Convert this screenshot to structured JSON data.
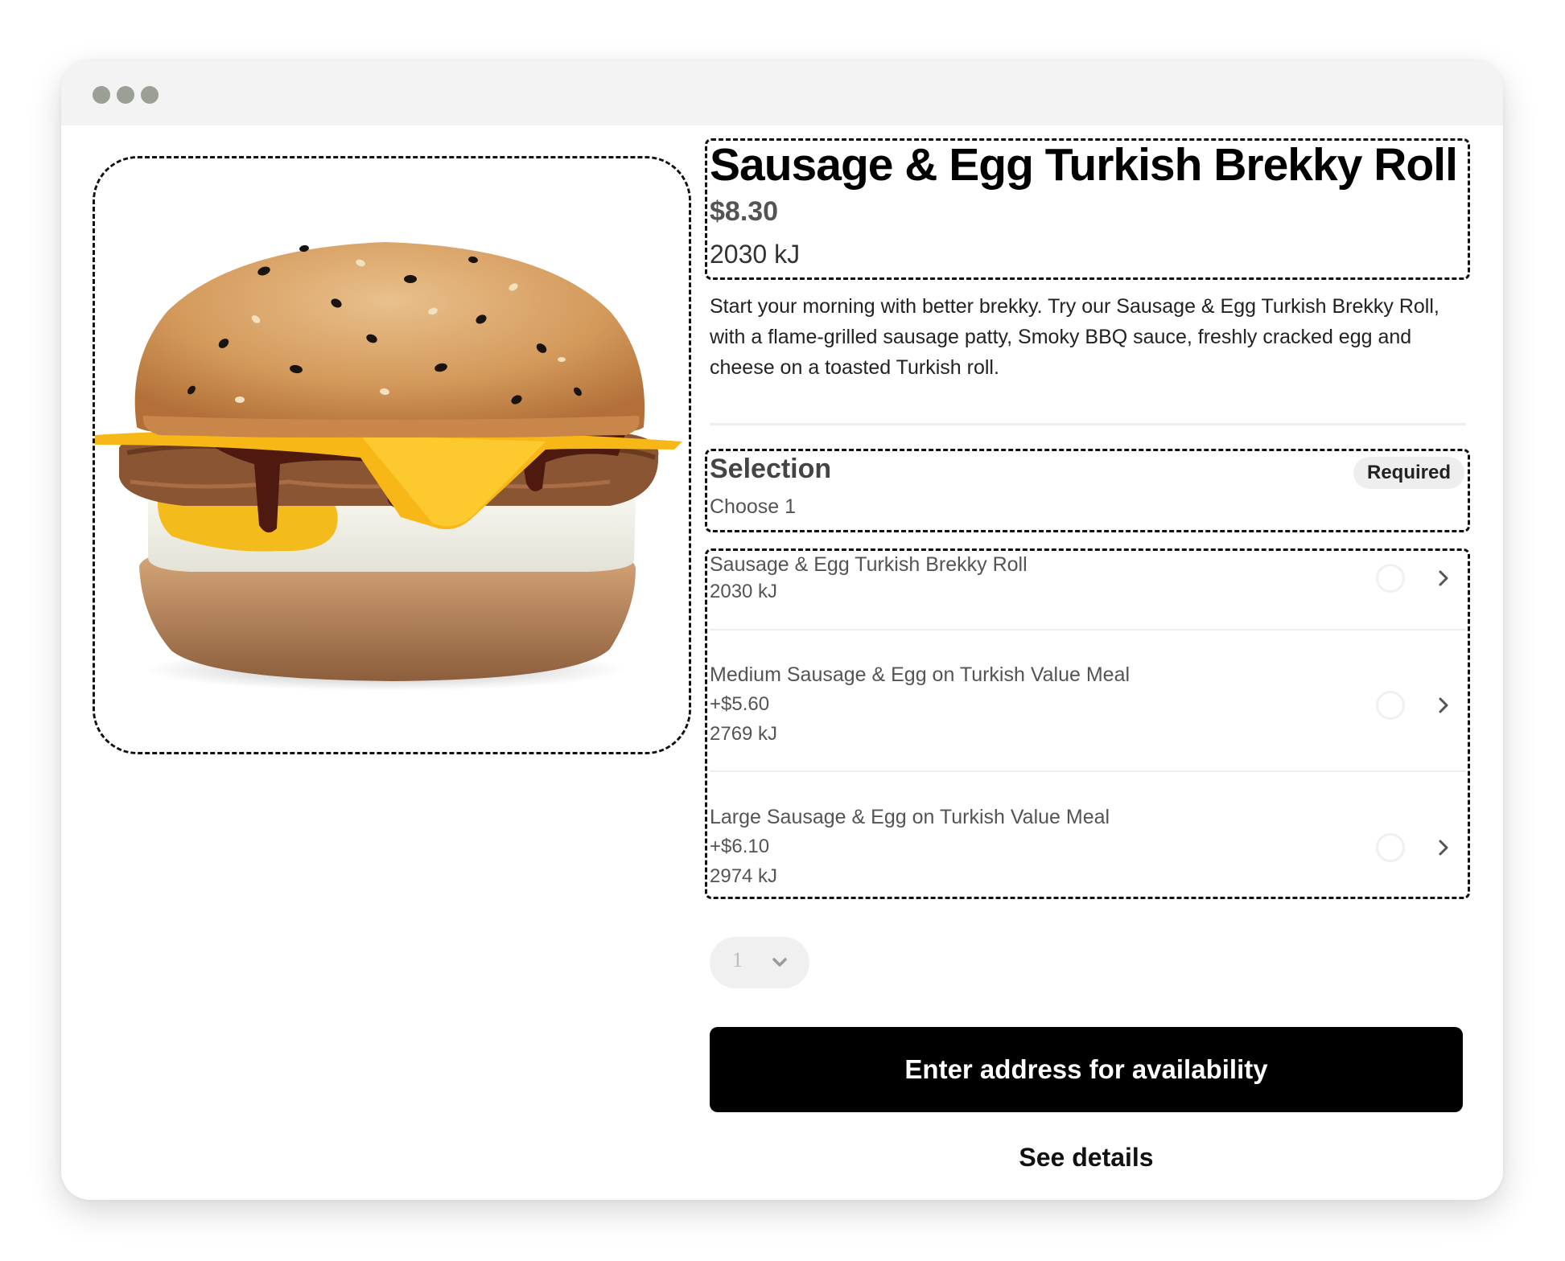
{
  "window": {
    "control_dot_color": "#9aa095"
  },
  "product": {
    "image_alt": "Sausage & Egg Turkish Brekky Roll",
    "title": "Sausage & Egg Turkish Brekky Roll",
    "price": "$8.30",
    "energy": "2030 kJ",
    "description": "Start your morning with better brekky. Try our Sausage & Egg Turkish Brekky Roll, with a flame-grilled sausage patty, Smoky BBQ sauce, freshly cracked egg and cheese on a toasted Turkish roll."
  },
  "selection": {
    "title": "Selection",
    "subtitle": "Choose 1",
    "required_label": "Required",
    "options": [
      {
        "name": "Sausage & Egg Turkish Brekky Roll",
        "price_delta": "",
        "energy": "2030 kJ",
        "selected": false
      },
      {
        "name": "Medium Sausage & Egg on Turkish Value Meal",
        "price_delta": "+$5.60",
        "energy": "2769 kJ",
        "selected": false
      },
      {
        "name": "Large Sausage & Egg on Turkish Value Meal",
        "price_delta": "+$6.10",
        "energy": "2974 kJ",
        "selected": false
      }
    ]
  },
  "quantity": {
    "value": "1",
    "icon": "chevron-down-icon"
  },
  "actions": {
    "primary_label": "Enter address for availability",
    "secondary_label": "See details"
  },
  "colors": {
    "primary_button": "#000000",
    "muted_text": "#545454",
    "badge_bg": "#eeeeee"
  }
}
